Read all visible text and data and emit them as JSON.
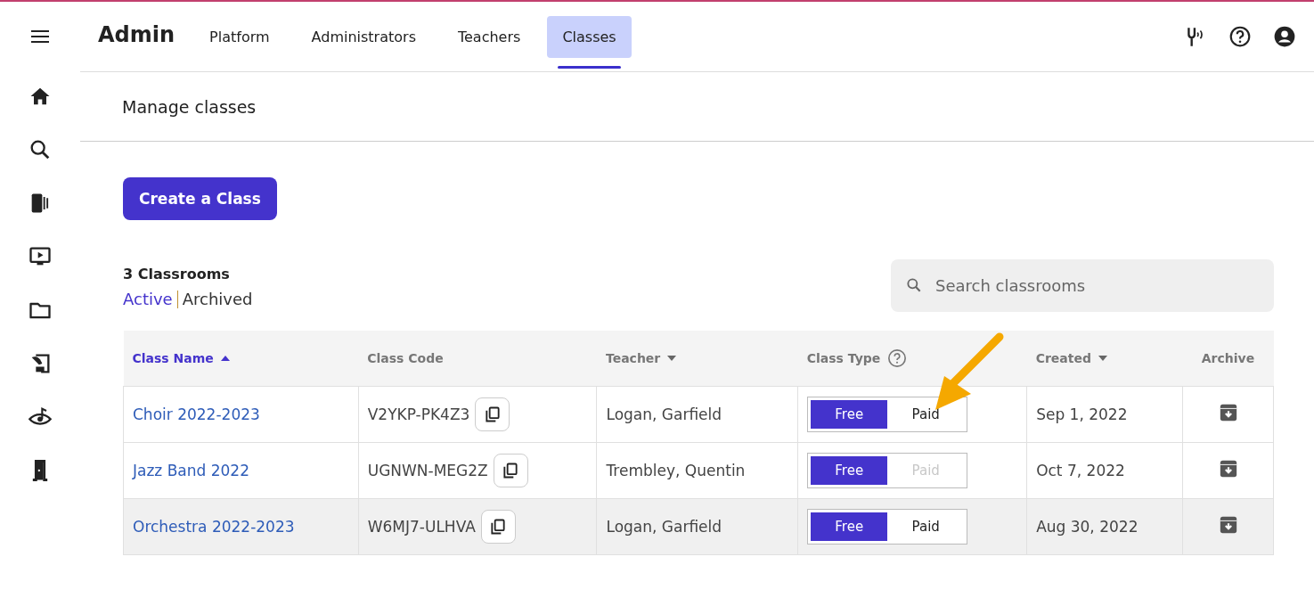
{
  "header": {
    "brand": "Admin",
    "tabs": [
      {
        "label": "Platform",
        "selected": false
      },
      {
        "label": "Administrators",
        "selected": false
      },
      {
        "label": "Teachers",
        "selected": false
      },
      {
        "label": "Classes",
        "selected": true
      }
    ]
  },
  "page_title": "Manage classes",
  "create_button": "Create a Class",
  "count": "3 Classrooms",
  "filters": [
    {
      "label": "Active",
      "selected": true
    },
    {
      "label": "Archived",
      "selected": false
    }
  ],
  "search": {
    "placeholder": "Search classrooms"
  },
  "table": {
    "columns": [
      {
        "label": "Class Name",
        "sort_up": true,
        "sort_down": false,
        "active": true,
        "help": false
      },
      {
        "label": "Class Code",
        "sort_up": false,
        "sort_down": false,
        "active": false,
        "help": false
      },
      {
        "label": "Teacher",
        "sort_up": false,
        "sort_down": true,
        "active": false,
        "help": false
      },
      {
        "label": "Class Type",
        "sort_up": false,
        "sort_down": false,
        "active": false,
        "help": true
      },
      {
        "label": "Created",
        "sort_up": false,
        "sort_down": true,
        "active": false,
        "help": false
      },
      {
        "label": "Archive",
        "sort_up": false,
        "sort_down": false,
        "active": false,
        "help": false
      }
    ],
    "rows": [
      {
        "name": "Choir 2022-2023",
        "code": "V2YKP-PK4Z3",
        "teacher": "Logan, Garfield",
        "type": [
          {
            "label": "Free",
            "selected": true,
            "disabled": false
          },
          {
            "label": "Paid",
            "selected": false,
            "disabled": false
          }
        ],
        "created": "Sep 1, 2022",
        "highlighted": false
      },
      {
        "name": "Jazz Band 2022",
        "code": "UGNWN-MEG2Z",
        "teacher": "Trembley, Quentin",
        "type": [
          {
            "label": "Free",
            "selected": true,
            "disabled": false
          },
          {
            "label": "Paid",
            "selected": false,
            "disabled": true
          }
        ],
        "created": "Oct 7, 2022",
        "highlighted": false
      },
      {
        "name": "Orchestra 2022-2023",
        "code": "W6MJ7-ULHVA",
        "teacher": "Logan, Garfield",
        "type": [
          {
            "label": "Free",
            "selected": true,
            "disabled": false
          },
          {
            "label": "Paid",
            "selected": false,
            "disabled": false
          }
        ],
        "created": "Aug 30, 2022",
        "highlighted": true
      }
    ]
  }
}
